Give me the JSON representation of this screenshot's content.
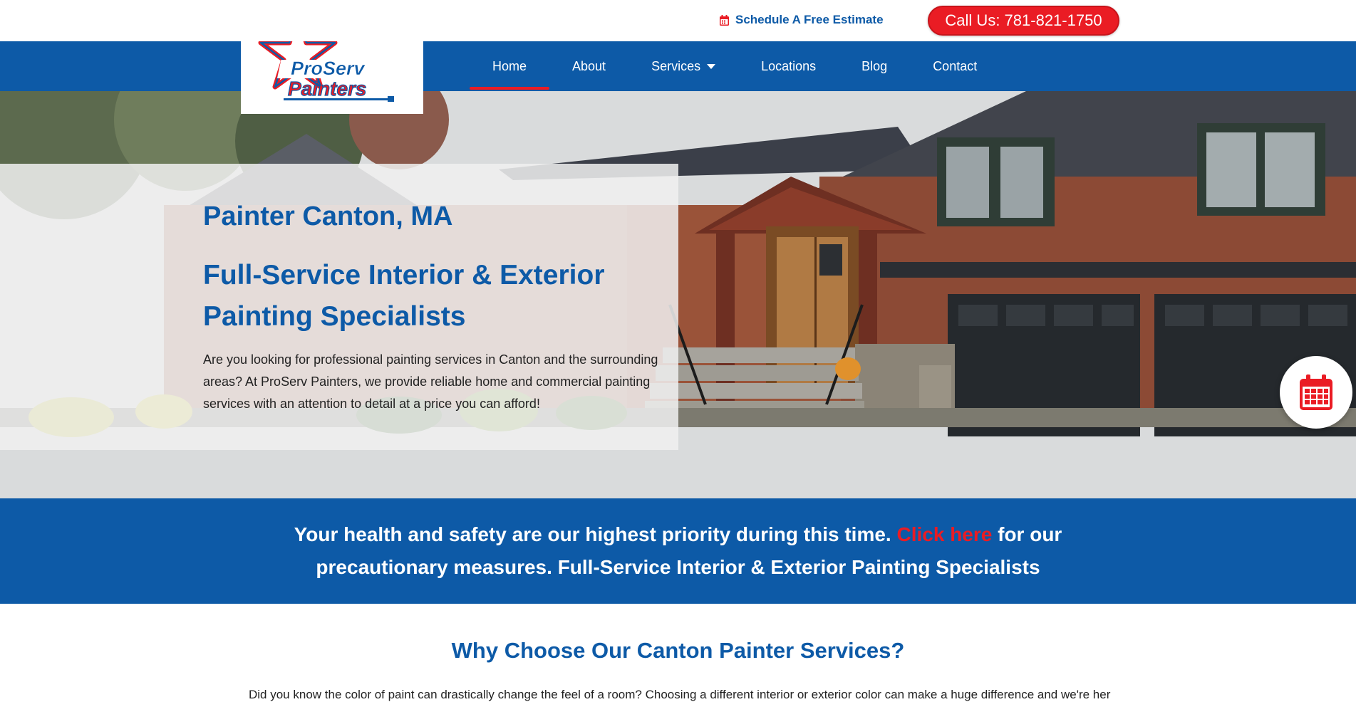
{
  "topbar": {
    "estimate_label": "Schedule A Free Estimate",
    "call_label": "Call Us: 781-821-1750"
  },
  "logo": {
    "line1": "ProServ",
    "line2": "Painters"
  },
  "nav": {
    "home": "Home",
    "about": "About",
    "services": "Services",
    "locations": "Locations",
    "blog": "Blog",
    "contact": "Contact"
  },
  "hero": {
    "title": "Painter Canton, MA",
    "subtitle": "Full-Service Interior & Exterior Painting Specialists",
    "text": "Are you looking for professional painting services in Canton and the surrounding areas? At ProServ Painters, we provide reliable home and commercial painting services with an attention to detail at a price you can afford!"
  },
  "banner": {
    "text_before": "Your health and safety are our highest priority during this time. ",
    "link": "Click here",
    "text_after": " for our precautionary measures. Full-Service Interior & Exterior Painting Specialists"
  },
  "why": {
    "title": "Why Choose Our Canton Painter Services?",
    "text": "Did you know the color of paint can drastically change the feel of a room? Choosing a different interior or exterior color can make a huge difference and we're here to prove"
  },
  "colors": {
    "brand_blue": "#0d5aa7",
    "accent_red": "#ea1c24"
  },
  "icons": {
    "estimate": "calendar-icon",
    "floating": "calendar-icon",
    "services_dropdown": "chevron-down-icon"
  }
}
